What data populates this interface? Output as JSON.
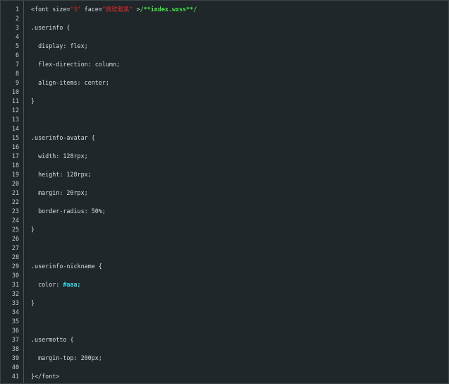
{
  "editor": {
    "lines": [
      {
        "n": "1",
        "segments": [
          {
            "t": "<font size=",
            "c": ""
          },
          {
            "t": "\"3\"",
            "c": "str"
          },
          {
            "t": " face=",
            "c": ""
          },
          {
            "t": "\"微软雅黑\"",
            "c": "str"
          },
          {
            "t": " >",
            "c": ""
          },
          {
            "t": "/**index.wxss**/",
            "c": "green"
          }
        ]
      },
      {
        "n": "2",
        "segments": []
      },
      {
        "n": "3",
        "segments": [
          {
            "t": ".userinfo {",
            "c": ""
          }
        ]
      },
      {
        "n": "4",
        "segments": []
      },
      {
        "n": "5",
        "segments": [
          {
            "t": "  display: flex;",
            "c": ""
          }
        ]
      },
      {
        "n": "6",
        "segments": []
      },
      {
        "n": "7",
        "segments": [
          {
            "t": "  flex-direction: column;",
            "c": ""
          }
        ]
      },
      {
        "n": "8",
        "segments": []
      },
      {
        "n": "9",
        "segments": [
          {
            "t": "  align-items: center;",
            "c": ""
          }
        ]
      },
      {
        "n": "10",
        "segments": []
      },
      {
        "n": "11",
        "segments": [
          {
            "t": "}",
            "c": ""
          }
        ]
      },
      {
        "n": "12",
        "segments": []
      },
      {
        "n": "13",
        "segments": []
      },
      {
        "n": "14",
        "segments": []
      },
      {
        "n": "15",
        "segments": [
          {
            "t": ".userinfo-avatar {",
            "c": ""
          }
        ]
      },
      {
        "n": "16",
        "segments": []
      },
      {
        "n": "17",
        "segments": [
          {
            "t": "  width: 128rpx;",
            "c": ""
          }
        ]
      },
      {
        "n": "18",
        "segments": []
      },
      {
        "n": "19",
        "segments": [
          {
            "t": "  height: 128rpx;",
            "c": ""
          }
        ]
      },
      {
        "n": "20",
        "segments": []
      },
      {
        "n": "21",
        "segments": [
          {
            "t": "  margin: 20rpx;",
            "c": ""
          }
        ]
      },
      {
        "n": "22",
        "segments": []
      },
      {
        "n": "23",
        "segments": [
          {
            "t": "  border-radius: 50%;",
            "c": ""
          }
        ]
      },
      {
        "n": "24",
        "segments": []
      },
      {
        "n": "25",
        "segments": [
          {
            "t": "}",
            "c": ""
          }
        ]
      },
      {
        "n": "26",
        "segments": []
      },
      {
        "n": "27",
        "segments": []
      },
      {
        "n": "28",
        "segments": []
      },
      {
        "n": "29",
        "segments": [
          {
            "t": ".userinfo-nickname {",
            "c": ""
          }
        ]
      },
      {
        "n": "30",
        "segments": []
      },
      {
        "n": "31",
        "segments": [
          {
            "t": "  color: ",
            "c": ""
          },
          {
            "t": "#aaa;",
            "c": "cyan"
          }
        ]
      },
      {
        "n": "32",
        "segments": []
      },
      {
        "n": "33",
        "segments": [
          {
            "t": "}",
            "c": ""
          }
        ]
      },
      {
        "n": "34",
        "segments": []
      },
      {
        "n": "35",
        "segments": []
      },
      {
        "n": "36",
        "segments": []
      },
      {
        "n": "37",
        "segments": [
          {
            "t": ".usermotto {",
            "c": ""
          }
        ]
      },
      {
        "n": "38",
        "segments": []
      },
      {
        "n": "39",
        "segments": [
          {
            "t": "  margin-top: 200px;",
            "c": ""
          }
        ]
      },
      {
        "n": "40",
        "segments": []
      },
      {
        "n": "41",
        "segments": [
          {
            "t": "}</font>",
            "c": ""
          }
        ]
      }
    ]
  },
  "colors": {
    "background": "#1f272b",
    "text": "#d7dcdf",
    "line_number": "#c6ccd0",
    "string": "#e02a2a",
    "comment_green": "#47e547",
    "color_value": "#39d6e0"
  }
}
